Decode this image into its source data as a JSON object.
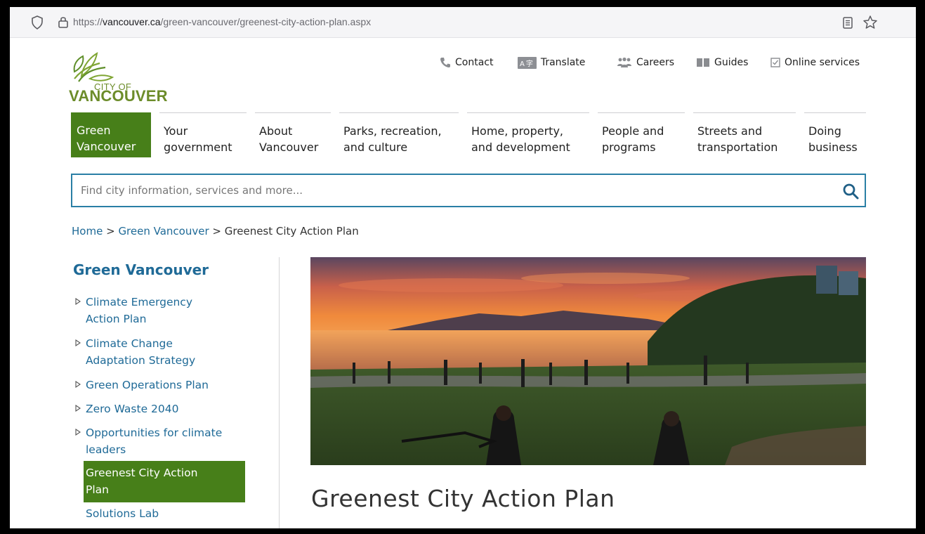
{
  "browser": {
    "url_prefix": "https://",
    "url_host": "vancouver.ca",
    "url_path": "/green-vancouver/greenest-city-action-plan.aspx"
  },
  "logo": {
    "city_of": "CITY OF",
    "name": "VANCOUVER"
  },
  "utility": {
    "contact": "Contact",
    "translate_badge": "A字",
    "translate": "Translate",
    "careers": "Careers",
    "guides": "Guides",
    "online_services": "Online services"
  },
  "nav": [
    {
      "line1": "Green",
      "line2": "Vancouver"
    },
    {
      "line1": "Your",
      "line2": "government"
    },
    {
      "line1": "About",
      "line2": "Vancouver"
    },
    {
      "line1": "Parks, recreation,",
      "line2": "and culture"
    },
    {
      "line1": "Home, property,",
      "line2": "and development"
    },
    {
      "line1": "People and",
      "line2": "programs"
    },
    {
      "line1": "Streets and",
      "line2": "transportation"
    },
    {
      "line1": "Doing",
      "line2": "business"
    }
  ],
  "search": {
    "placeholder": "Find city information, services and more..."
  },
  "breadcrumb": {
    "home": "Home",
    "sep": ">",
    "section": "Green Vancouver",
    "current": "Greenest City Action Plan"
  },
  "sidebar": {
    "title": "Green Vancouver",
    "items": [
      {
        "line1": "Climate Emergency",
        "line2": "Action Plan"
      },
      {
        "line1": "Climate Change",
        "line2": "Adaptation Strategy"
      },
      {
        "line1": "Green Operations Plan",
        "line2": ""
      },
      {
        "line1": "Zero Waste 2040",
        "line2": ""
      },
      {
        "line1": "Opportunities for climate",
        "line2": "leaders"
      }
    ],
    "active": {
      "line1": "Greenest City Action",
      "line2": "Plan"
    },
    "extra": "Solutions Lab"
  },
  "page": {
    "title": "Greenest City Action Plan"
  },
  "colors": {
    "brand_green": "#477f19",
    "link_blue": "#1f6a97",
    "search_border": "#2a7fa5"
  }
}
